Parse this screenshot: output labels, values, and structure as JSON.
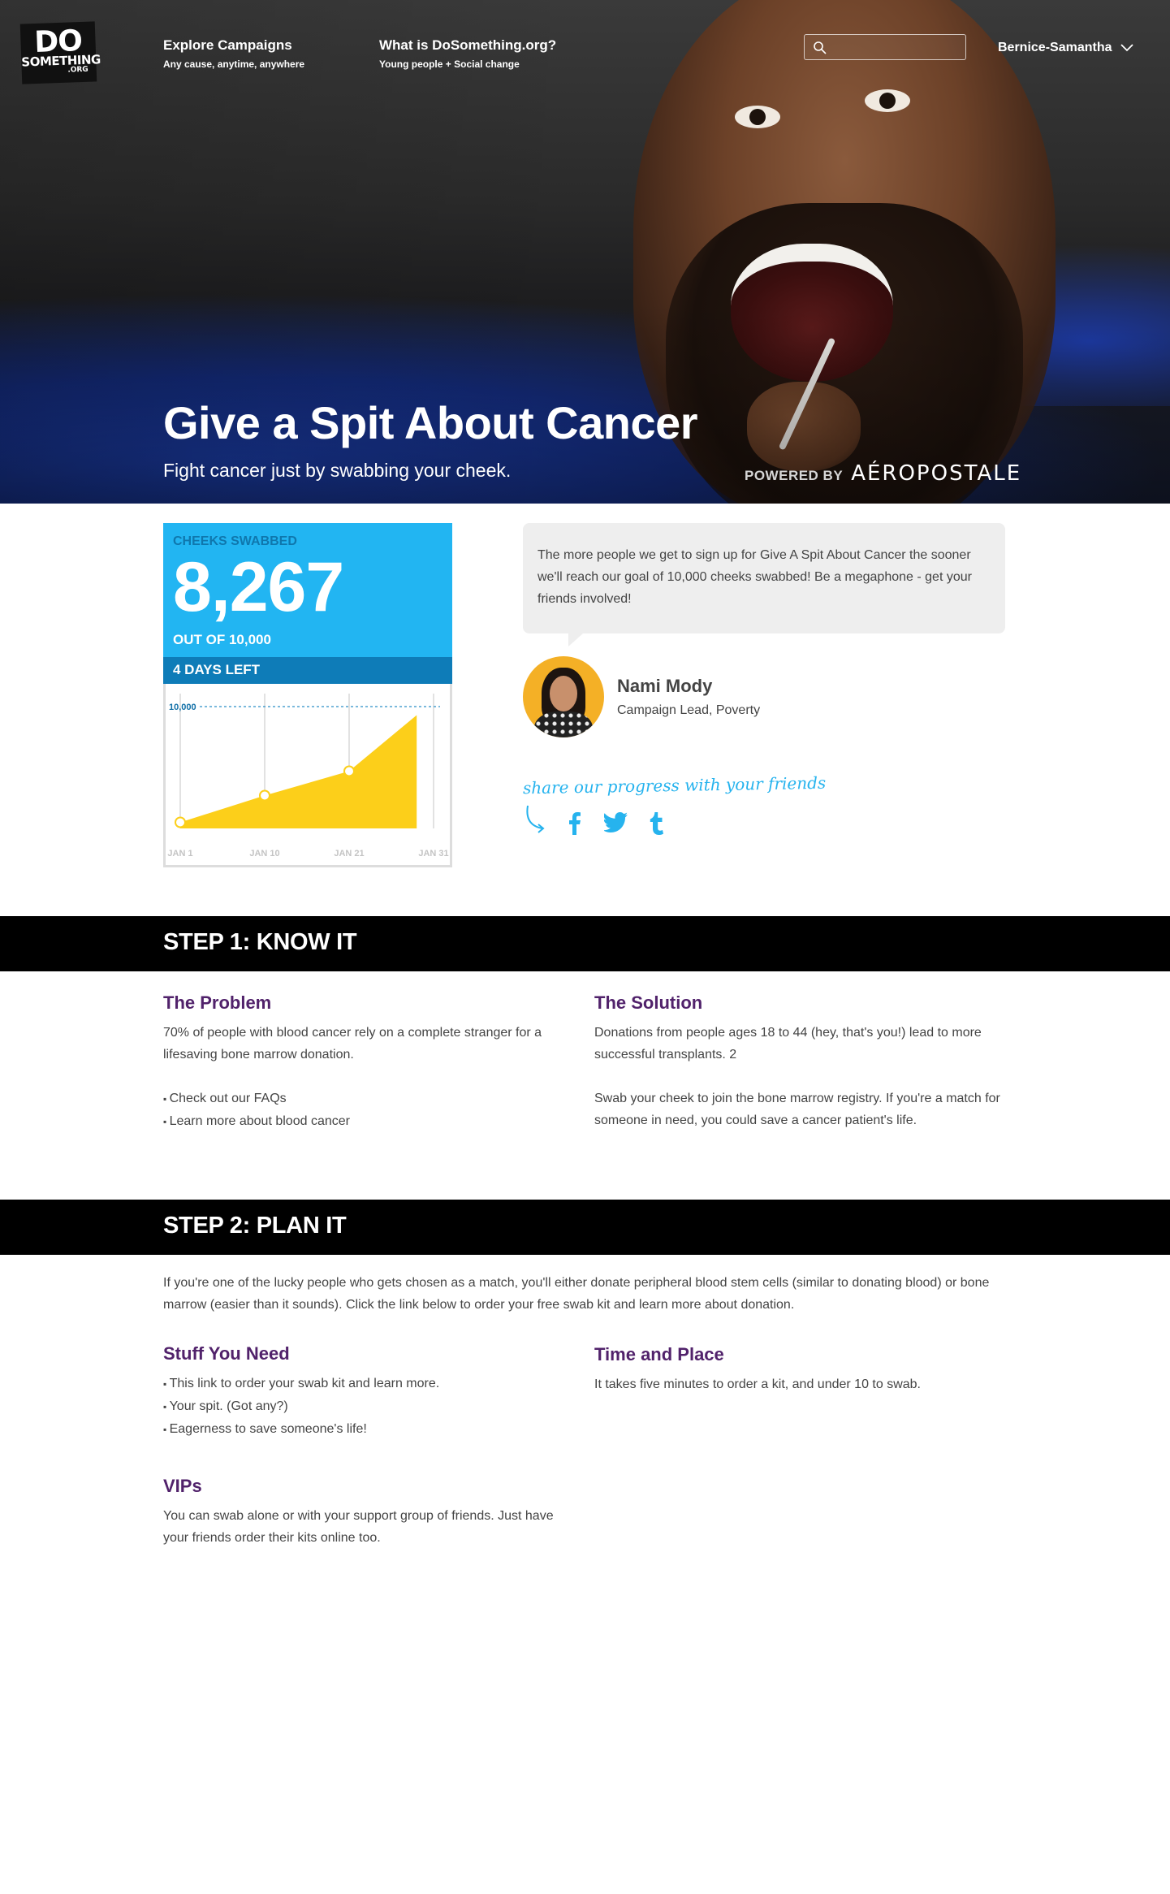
{
  "nav": {
    "logo": {
      "line1": "DO",
      "line2": "SOMETHING",
      "line3": ".ORG"
    },
    "explore": {
      "title": "Explore Campaigns",
      "subtitle": "Any cause, anytime, anywhere"
    },
    "about": {
      "title": "What is DoSomething.org?",
      "subtitle": "Young people + Social change"
    },
    "search": {
      "placeholder": "",
      "value": ""
    },
    "user": "Bernice-Samantha"
  },
  "hero": {
    "title": "Give a Spit About Cancer",
    "subtitle": "Fight cancer just by swabbing your cheek.",
    "powered_by": "POWERED BY",
    "sponsor": "AÉROPOSTALE"
  },
  "progress": {
    "label": "CHEEKS SWABBED",
    "count": "8,267",
    "goal_text": "OUT OF 10,000",
    "days_left": "4 DAYS LEFT"
  },
  "chart_data": {
    "type": "area",
    "x": [
      "JAN 1",
      "JAN 10",
      "JAN 21",
      "JAN 31"
    ],
    "values": [
      500,
      2700,
      4700,
      9300
    ],
    "goal": 10000,
    "goal_label": "10,000",
    "ylim": [
      0,
      11200
    ],
    "colors": {
      "fill": "#fccf1a",
      "goal_line": "#2a8fc7"
    }
  },
  "lead": {
    "quote": "The more people we get to sign up for Give A Spit About Cancer the sooner we'll reach our goal of 10,000 cheeks swabbed! Be a megaphone - get your friends involved!",
    "name": "Nami Mody",
    "role": "Campaign Lead, Poverty"
  },
  "share": {
    "prompt": "share our progress with your friends",
    "icons": [
      "facebook-icon",
      "twitter-icon",
      "tumblr-icon"
    ]
  },
  "step1": {
    "title": "STEP 1: KNOW IT",
    "problem": {
      "heading": "The Problem",
      "text": "70% of people with blood cancer rely on a complete stranger for a lifesaving bone marrow donation.",
      "links": [
        "Check out our FAQs",
        "Learn more about blood cancer"
      ]
    },
    "solution": {
      "heading": "The Solution",
      "text1": "Donations from people ages 18 to 44 (hey, that's you!) lead to more successful transplants. 2",
      "text2": "Swab your cheek to join the bone marrow registry. If you're a match for someone in need, you could save a cancer patient's life."
    }
  },
  "step2": {
    "title": "STEP 2: PLAN IT",
    "intro": "If you're one of the lucky people who gets chosen as a match, you'll either donate peripheral blood stem cells (similar to donating blood) or bone marrow (easier than it sounds). Click the link below to order your free swab kit and learn more about donation.",
    "stuff": {
      "heading": "Stuff You Need",
      "items": [
        "This link to order your swab kit and learn more.",
        "Your spit. (Got any?)",
        "Eagerness to save someone's life!"
      ]
    },
    "time": {
      "heading": "Time and Place",
      "text": "It takes five minutes to order a kit, and under 10 to swab."
    },
    "vips": {
      "heading": "VIPs",
      "text": "You can swab alone or with your support group of friends. Just have your friends order their kits online too."
    }
  },
  "colors": {
    "brand_blue": "#22b5f2",
    "dark_blue": "#0e7cb8",
    "heading_purple": "#51226b",
    "chart_yellow": "#fccf1a"
  }
}
